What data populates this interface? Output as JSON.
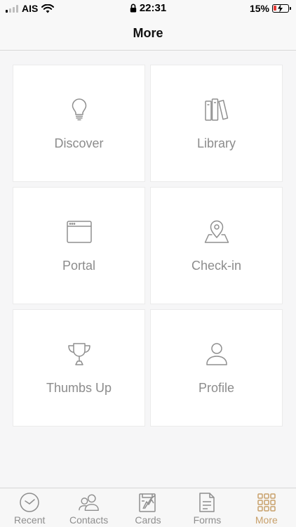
{
  "status_bar": {
    "carrier": "AIS",
    "time": "22:31",
    "battery_percent": "15%",
    "battery_color": "#e53935"
  },
  "nav": {
    "title": "More"
  },
  "tiles": [
    {
      "label": "Discover",
      "icon": "lightbulb-icon"
    },
    {
      "label": "Library",
      "icon": "books-icon"
    },
    {
      "label": "Portal",
      "icon": "browser-window-icon"
    },
    {
      "label": "Check-in",
      "icon": "map-pin-icon"
    },
    {
      "label": "Thumbs Up",
      "icon": "trophy-icon"
    },
    {
      "label": "Profile",
      "icon": "person-icon"
    }
  ],
  "tab_bar": {
    "items": [
      {
        "label": "Recent",
        "icon": "clock-icon"
      },
      {
        "label": "Contacts",
        "icon": "contacts-icon"
      },
      {
        "label": "Cards",
        "icon": "cards-icon"
      },
      {
        "label": "Forms",
        "icon": "document-icon"
      },
      {
        "label": "More",
        "icon": "grid-icon",
        "active": true
      }
    ],
    "active_color": "#c8a06a"
  }
}
